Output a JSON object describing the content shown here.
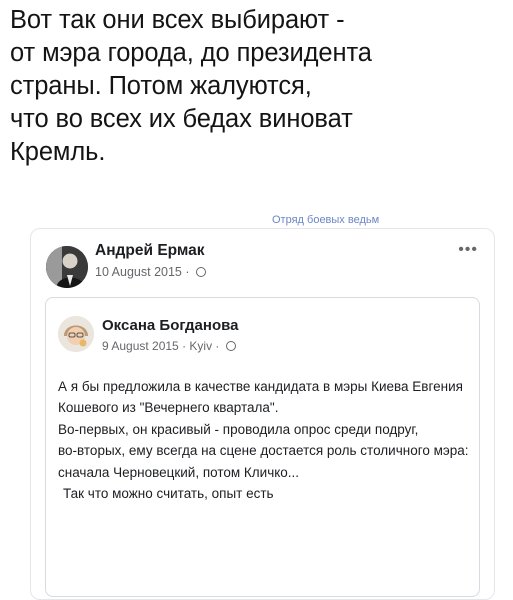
{
  "caption": {
    "lines": [
      "Вот так они всех выбирают -",
      "от мэра города, до президента",
      "страны. Потом жалуются,",
      "что во всех их бедах виноват",
      "Кремль."
    ]
  },
  "watermark": "Отряд боевых ведьм",
  "post": {
    "author": "Андрей Ермак",
    "date": "10 August 2015",
    "separator": " · ",
    "more_icon": "more-horizontal-icon",
    "privacy_icon": "globe-icon"
  },
  "shared": {
    "author": "Оксана Богданова",
    "date": "9 August 2015",
    "location": "Kyiv",
    "separator": " · ",
    "paragraphs": [
      "А я бы предложила в качестве кандидата в мэры Киева Евгения Кошевого из \"Вечернего квартала\".",
      "Во-первых, он красивый - проводила опрос среди подруг,",
      "во-вторых, ему всегда на сцене достается роль столичного мэра: сначала Черновецкий, потом Кличко...",
      "Так что можно считать, опыт есть"
    ]
  }
}
